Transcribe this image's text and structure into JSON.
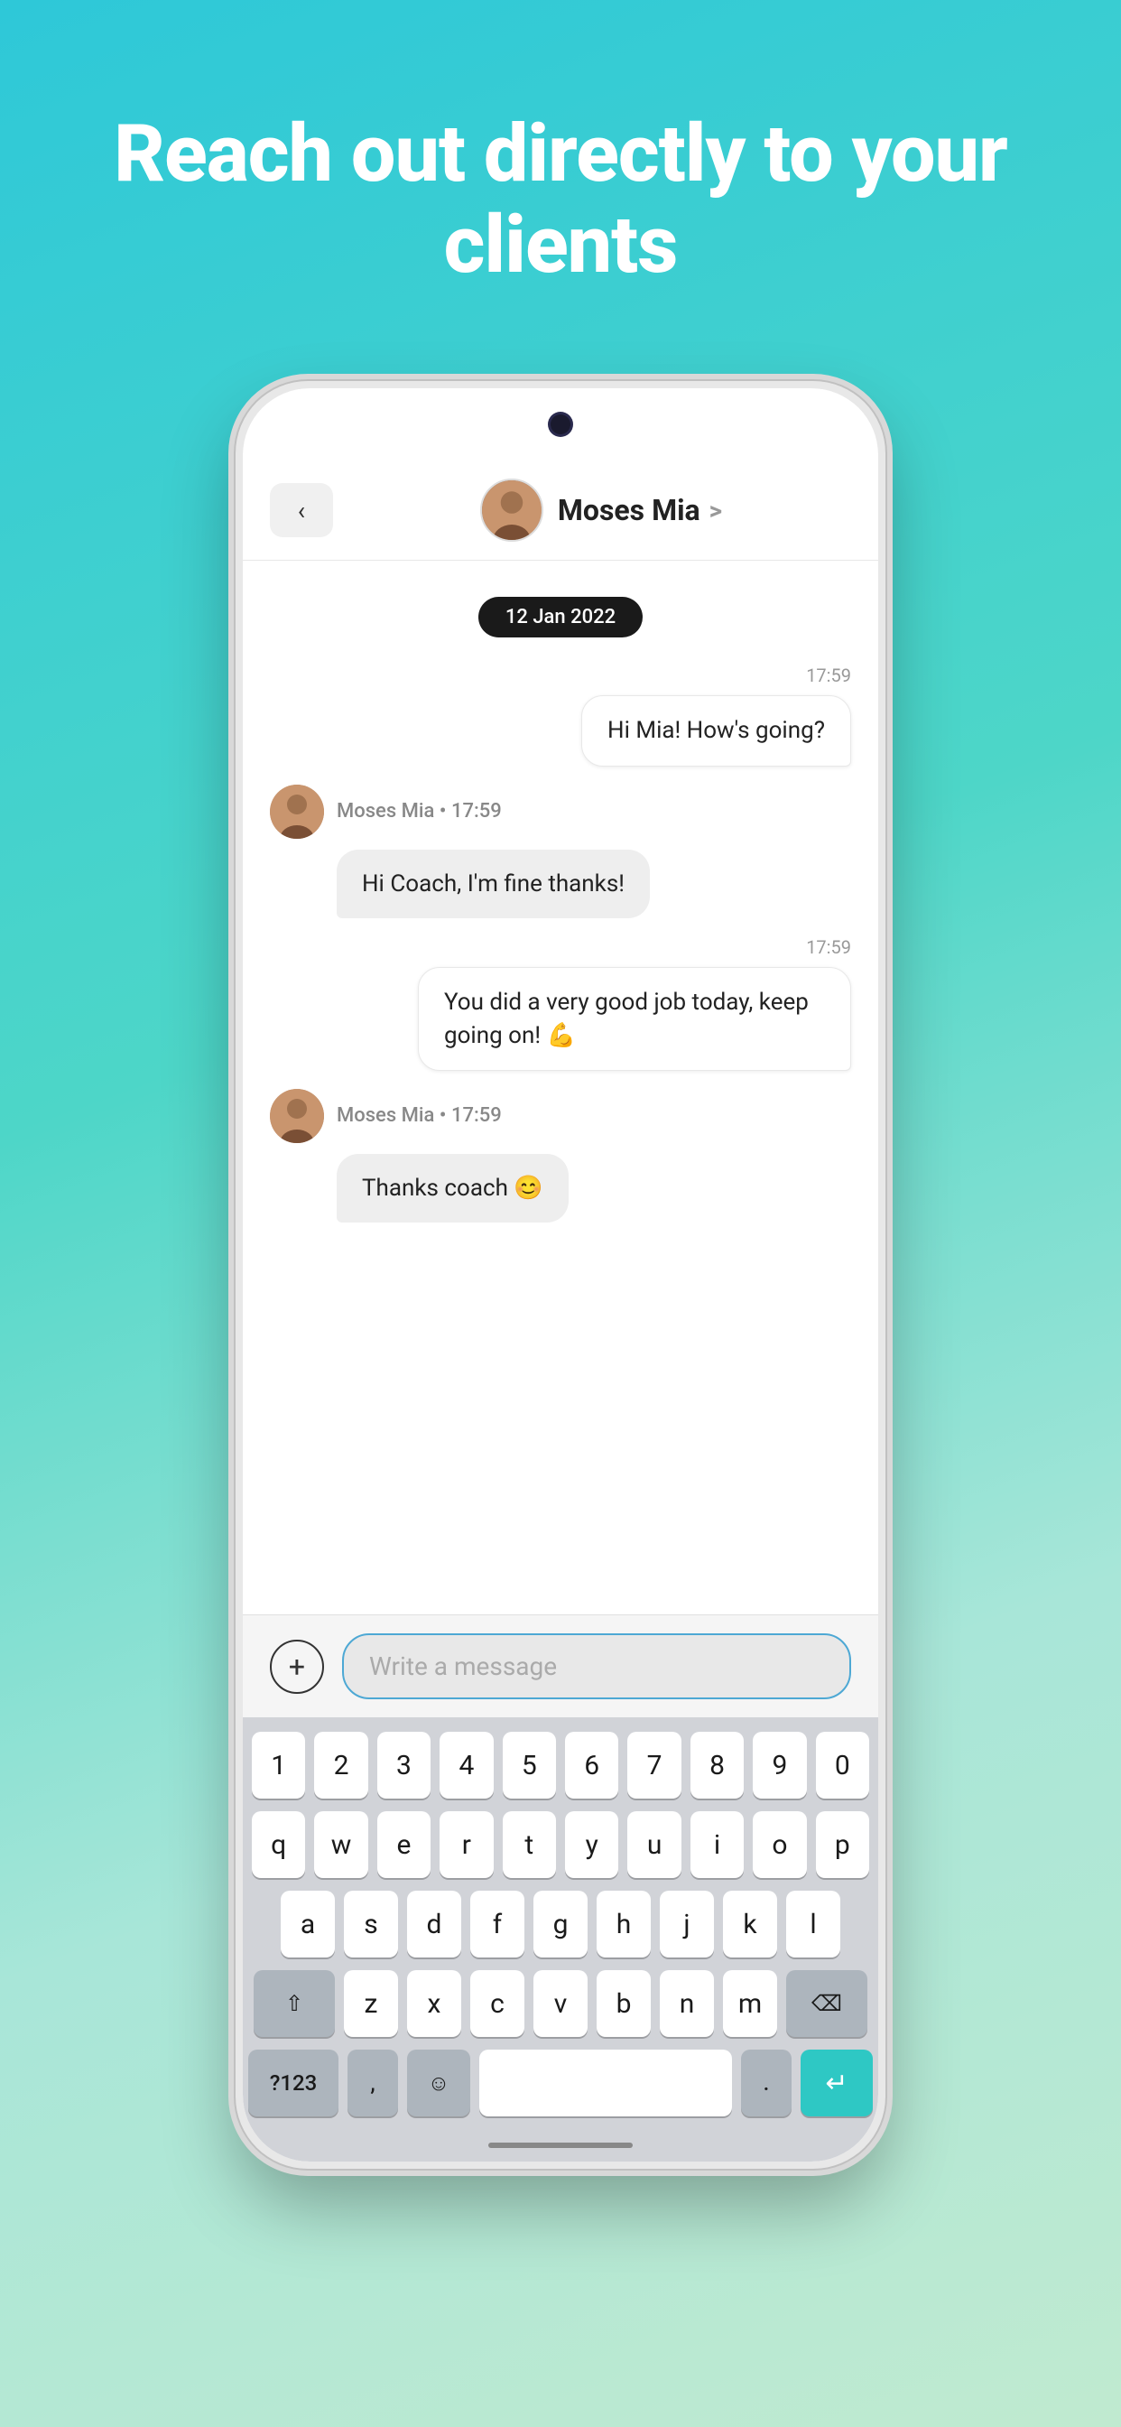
{
  "hero": {
    "title": "Reach out directly to your clients"
  },
  "chat": {
    "contact_name": "Moses Mia",
    "back_label": "<",
    "chevron": ">",
    "date": "12 Jan 2022",
    "messages": [
      {
        "id": "msg1",
        "type": "sent",
        "time": "17:59",
        "text": "Hi Mia! How's going?"
      },
      {
        "id": "msg2",
        "type": "received",
        "sender": "Moses Mia",
        "time": "17:59",
        "text": "Hi Coach, I'm fine thanks!"
      },
      {
        "id": "msg3",
        "type": "sent",
        "time": "17:59",
        "text": "You did a very good job today, keep going on! 💪"
      },
      {
        "id": "msg4",
        "type": "received",
        "sender": "Moses Mia",
        "time": "17:59",
        "text": "Thanks coach 😊"
      }
    ],
    "input_placeholder": "Write a message"
  },
  "keyboard": {
    "row1": [
      "1",
      "2",
      "3",
      "4",
      "5",
      "6",
      "7",
      "8",
      "9",
      "0"
    ],
    "row2": [
      "q",
      "w",
      "e",
      "r",
      "t",
      "y",
      "u",
      "i",
      "o",
      "p"
    ],
    "row3": [
      "a",
      "s",
      "d",
      "f",
      "g",
      "h",
      "j",
      "k",
      "l"
    ],
    "row4": [
      "z",
      "x",
      "c",
      "v",
      "b",
      "n",
      "m"
    ],
    "special": {
      "shift": "⇧",
      "backspace": "⌫",
      "numbers": "?123",
      "comma": ",",
      "emoji": "☺",
      "space": "",
      "period": ".",
      "enter": "↵"
    }
  }
}
